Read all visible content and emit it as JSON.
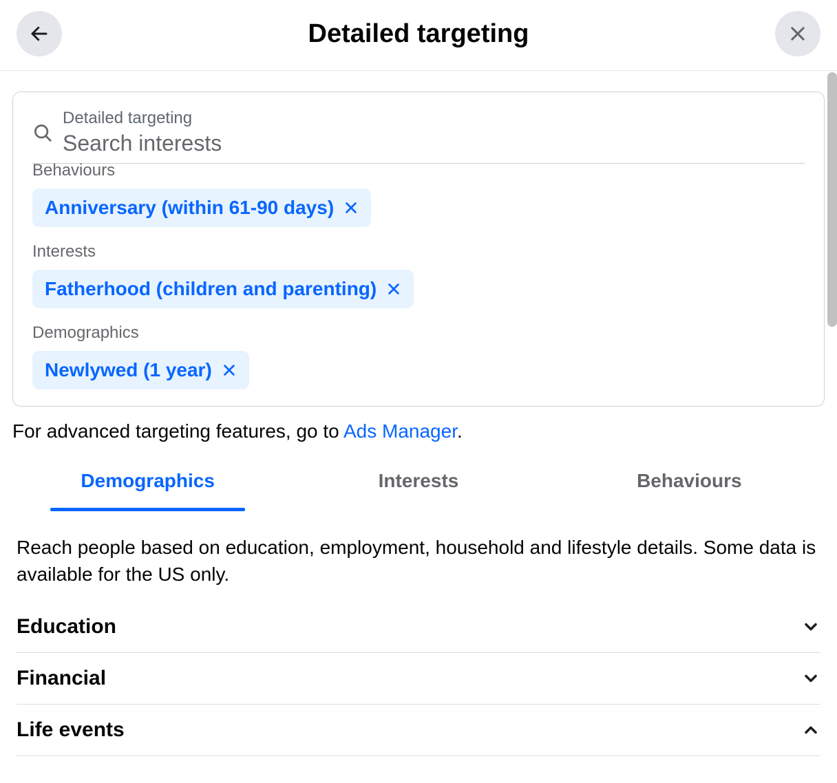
{
  "header": {
    "title": "Detailed targeting"
  },
  "search": {
    "label": "Detailed targeting",
    "placeholder": "Search interests"
  },
  "selected_groups": [
    {
      "category": "Behaviours",
      "chip": "Anniversary (within 61-90 days)"
    },
    {
      "category": "Interests",
      "chip": "Fatherhood (children and parenting)"
    },
    {
      "category": "Demographics",
      "chip": "Newlywed (1 year)"
    }
  ],
  "advanced": {
    "prefix": "For advanced targeting features, go to ",
    "link": "Ads Manager",
    "suffix": "."
  },
  "tabs": {
    "items": [
      "Demographics",
      "Interests",
      "Behaviours"
    ],
    "active_index": 0,
    "description": "Reach people based on education, employment, household and lifestyle details. Some data is available for the US only."
  },
  "accordion": [
    {
      "title": "Education",
      "expanded": false
    },
    {
      "title": "Financial",
      "expanded": false
    },
    {
      "title": "Life events",
      "expanded": true
    }
  ],
  "colors": {
    "accent": "#0866ff",
    "chip_bg": "#e7f3ff",
    "muted": "#65676b",
    "circle_btn": "#e4e6eb"
  }
}
